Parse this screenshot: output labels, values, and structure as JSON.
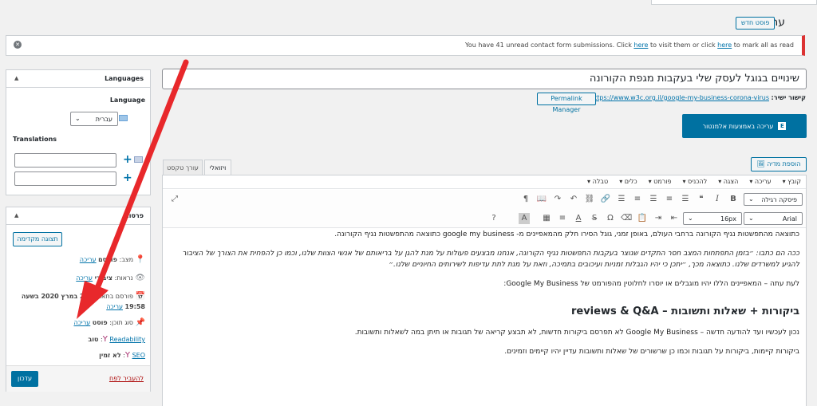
{
  "header": {
    "title": "עריכה",
    "new_post_label": "פוסט חדש"
  },
  "notice": {
    "prefix": "You have 41 unread contact form submissions. Click ",
    "link1": "here",
    "middle": " to visit them or click ",
    "link2": "here",
    "suffix": " to mark all as read"
  },
  "languages_box": {
    "title": "Languages",
    "language_label": "Language",
    "language_value": "עברית",
    "translations_label": "Translations"
  },
  "publish_box": {
    "title": "פרסום",
    "preview_label": "תצוגה מקדימה",
    "status_label": "מצב:",
    "status_value": "פורסם",
    "status_edit": "עריכה",
    "visibility_label": "נראות:",
    "visibility_value": "ציבורי",
    "visibility_edit": "עריכה",
    "published_label": "פורסם בתאריך:",
    "published_date": "25 במרץ 2020 בשעה 19:58",
    "published_edit": "עריכה",
    "type_label": "סוג תוכן:",
    "type_value": "פוסט",
    "type_edit": "עריכה",
    "readability_link": "Readability",
    "readability_value": "טוב",
    "seo_link": "SEO",
    "seo_value": "לא זמין",
    "trash_label": "להעביר לפח",
    "update_label": "עדכון"
  },
  "post": {
    "title": "שינויים בגוגל לעסק שלי בעקבות מגפת הקורונה",
    "permalink_label": "קישור ישיר:",
    "permalink_url": "https://www.w3c.org.il/google-my-business-corona-virus",
    "permalink_manager": "Permalink Manager",
    "elementor_label": "עריכה באמצעות אלמנטור",
    "add_media_label": "הוספת מדיה",
    "tab_visual": "ויזואלי",
    "tab_text": "עורך טקסט"
  },
  "editor": {
    "menu": [
      "קובץ",
      "עריכה",
      "הצגה",
      "להכניס",
      "פורמט",
      "כלים",
      "טבלה"
    ],
    "format_select": "פיסקה רגילה",
    "font_size": "16px",
    "font_family": "Arial",
    "paragraphs": [
      "כתוצאה מהתפשטות נגיף הקורונה ברחבי העולם, באופן זמני, גוגל הסירו חלק מהמאפיינים מ- google my business כתוצאה מהתפשטות נגיף הקורונה.",
      "ככה הם כתבו: ״בזמן התפתחות המצב חסר התקדים שנוצר בעקבות התפשטות נגיף הקורונה, אנחנו מבצעים פעולות על מנת להגן על בריאותם של אנשי הצוות שלנו, וכמו כן להפחית את הצורך של הציבור להגיע למשרדים שלנו. כתוצאה מכך, ״יתכן כי יהיו הגבלות זמניות ועיכובים בתמיכה, וזאת על מנת לתת עדיפות לשירותים החיוניים שלנו.״",
      "לעת עתה – המאפיינים הללו יהיו מוגבלים או יוסרו לחלוטין מהפורמט של Google My Business:"
    ],
    "heading": "ביקורות + שאלות ותשובות – reviews & Q&A",
    "paragraphs2": [
      "נכון לעכשיו ועד להודעה חדשה – Google My Business לא תפרסם ביקורות חדשות, לא תבצע קריאה של תגובות או תיתן במה לשאלות ותשובות.",
      "ביקורות קיימות, ביקורות על תגובות וכמו כן שרשורים של שאלות ותשובות עדיין יהיו קיימים וזמינים."
    ]
  },
  "colors": {
    "accent": "#0071a1",
    "arrow": "#e8282b",
    "notice_border": "#dc3232"
  }
}
